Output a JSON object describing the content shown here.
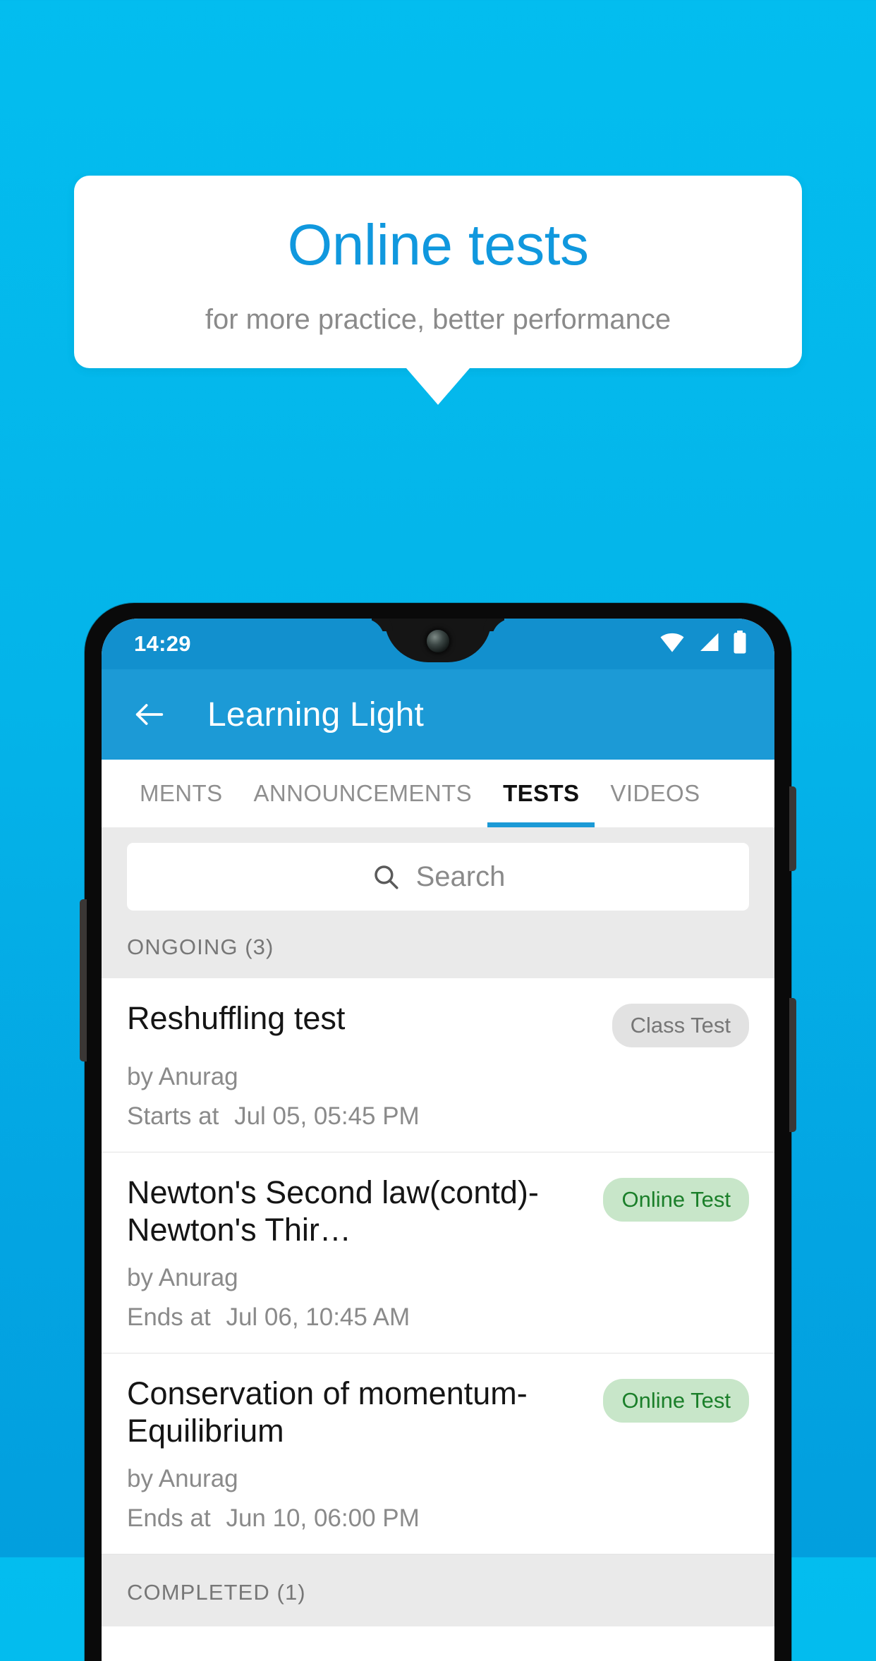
{
  "promo": {
    "title": "Online tests",
    "subtitle": "for more practice, better performance",
    "title_color": "#1098DE",
    "card_bg": "#FFFFFF",
    "background_top": "#03BDEF",
    "background_bottom": "#029FDE"
  },
  "phone": {
    "statusbar": {
      "time": "14:29",
      "icons": [
        "wifi-icon",
        "signal-icon",
        "battery-icon"
      ],
      "bg_color": "#1290CE"
    },
    "appbar": {
      "back_icon": "back-arrow-icon",
      "title": "Learning Light",
      "bg_color": "#1C9AD6"
    },
    "tabs": [
      {
        "label": "MENTS",
        "active": false
      },
      {
        "label": "ANNOUNCEMENTS",
        "active": false
      },
      {
        "label": "TESTS",
        "active": true
      },
      {
        "label": "VIDEOS",
        "active": false
      }
    ],
    "tab_indicator_color": "#1C9AD6",
    "search": {
      "icon": "search-icon",
      "placeholder": "Search",
      "value": ""
    },
    "sections": [
      {
        "label": "ONGOING (3)"
      },
      {
        "label": "COMPLETED (1)"
      }
    ],
    "tests": [
      {
        "title": "Reshuffling test",
        "badge": "Class Test",
        "badge_type": "class-test",
        "author": "by Anurag",
        "time_label": "Starts at",
        "time_value": "Jul 05, 05:45 PM"
      },
      {
        "title": "Newton's Second law(contd)-Newton's Thir…",
        "badge": "Online Test",
        "badge_type": "online-test",
        "author": "by Anurag",
        "time_label": "Ends at",
        "time_value": "Jul 06, 10:45 AM"
      },
      {
        "title": "Conservation of momentum-Equilibrium",
        "badge": "Online Test",
        "badge_type": "online-test",
        "author": "by Anurag",
        "time_label": "Ends at",
        "time_value": "Jun 10, 06:00 PM"
      }
    ]
  }
}
